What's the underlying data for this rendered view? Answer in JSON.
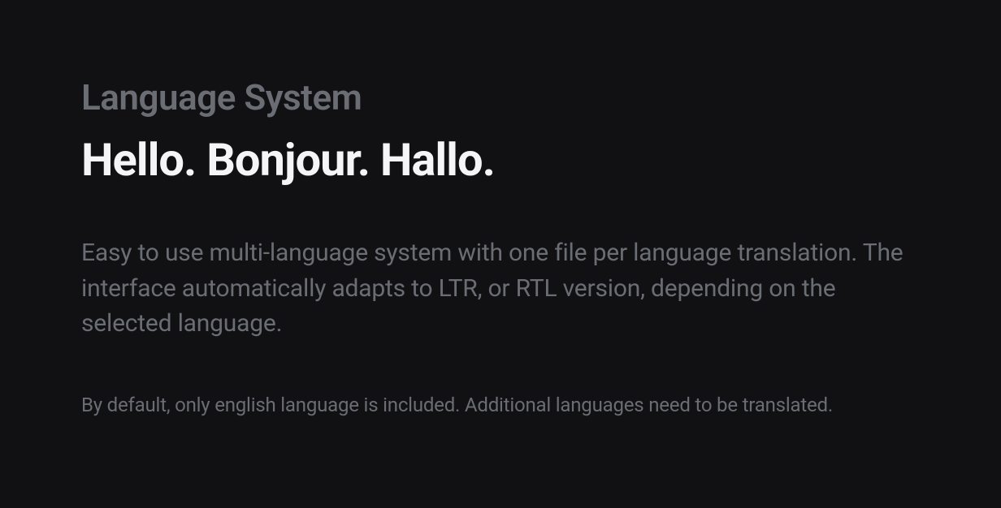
{
  "hero": {
    "eyebrow": "Language System",
    "headline": "Hello. Bonjour. Hallo.",
    "description": "Easy to use multi-language system with one file per language translation. The interface automatically adapts to LTR, or RTL version, depending on the selected language.",
    "note": "By default, only english language is included. Additional languages need to be translated."
  }
}
